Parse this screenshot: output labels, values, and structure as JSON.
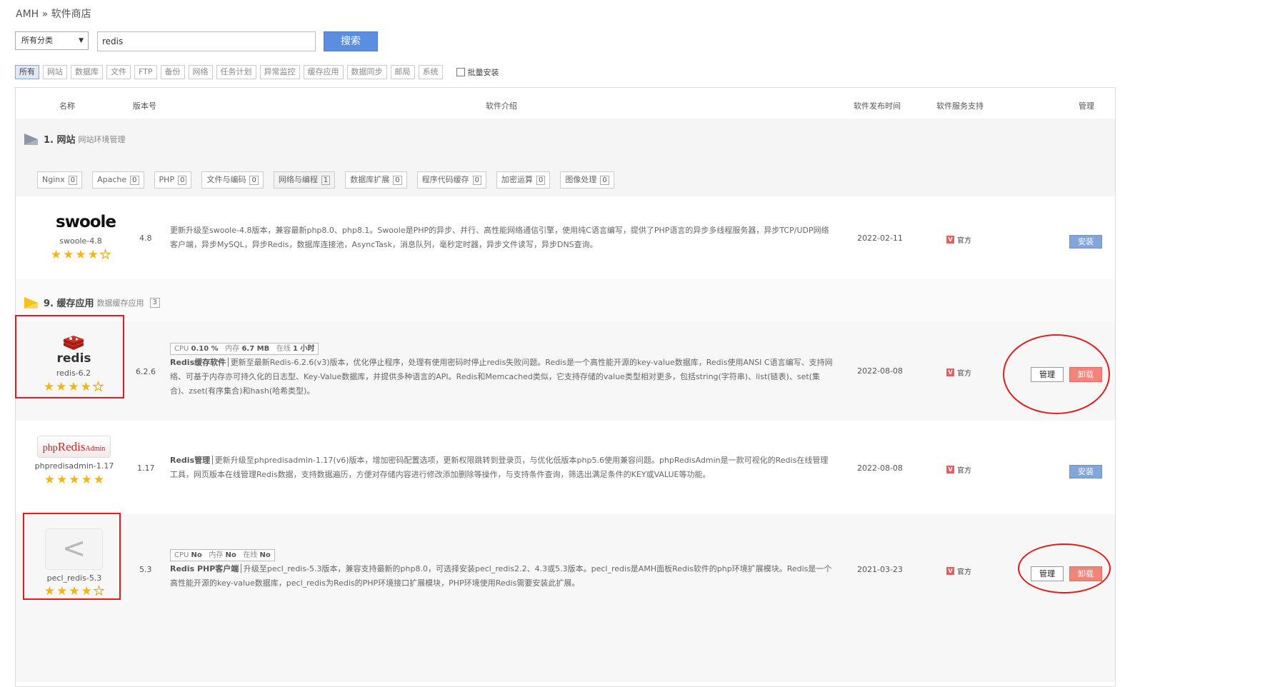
{
  "breadcrumb": "AMH » 软件商店",
  "search": {
    "category_value": "所有分类",
    "query": "redis",
    "button_label": "搜索"
  },
  "filter_tags": [
    "所有",
    "网站",
    "数据库",
    "文件",
    "FTP",
    "备份",
    "网络",
    "任务计划",
    "异常监控",
    "缓存应用",
    "数据同步",
    "邮局",
    "系统"
  ],
  "batch_install_label": "批量安装",
  "table_headers": {
    "name": "名称",
    "version": "版本号",
    "intro": "软件介绍",
    "release_date": "软件发布时间",
    "support": "软件服务支持",
    "manage": "管理"
  },
  "sections": {
    "website": {
      "title": "1. 网站",
      "desc": "网站环境管理",
      "subtags": [
        {
          "label": "Nginx",
          "count": "0"
        },
        {
          "label": "Apache",
          "count": "0"
        },
        {
          "label": "PHP",
          "count": "0"
        },
        {
          "label": "文件与编码",
          "count": "0"
        },
        {
          "label": "网络与编程",
          "count": "1"
        },
        {
          "label": "数据库扩展",
          "count": "0"
        },
        {
          "label": "程序代码缓存",
          "count": "0"
        },
        {
          "label": "加密运算",
          "count": "0"
        },
        {
          "label": "图像处理",
          "count": "0"
        }
      ]
    },
    "cache": {
      "title": "9. 缓存应用",
      "desc": "数据缓存应用",
      "count": "3"
    }
  },
  "packages": {
    "swoole": {
      "logo_text": "swoole",
      "name": "swoole-4.8",
      "version": "4.8",
      "rating": 4.5,
      "description": "更新升级至swoole-4.8版本，兼容最新php8.0、php8.1。Swoole是PHP的异步、并行、高性能网络通信引擎，使用纯C语言编写，提供了PHP语言的异步多线程服务器，异步TCP/UDP网络客户端，异步MySQL，异步Redis，数据库连接池，AsyncTask，消息队列，毫秒定时器，异步文件读写，异步DNS查询。",
      "release_date": "2022-02-11",
      "support_badge": "V",
      "support": "官方",
      "action": "安装"
    },
    "redis": {
      "logo_text": "redis",
      "name": "redis-6.2",
      "version": "6.2.6",
      "rating": 4.5,
      "stats": {
        "cpu_label": "CPU",
        "cpu": "0.10 %",
        "mem_label": "内存",
        "mem": "6.7 MB",
        "online_label": "在线",
        "online": "1 小时"
      },
      "desc_title": "Redis缓存软件",
      "description": "│更新至最新Redis-6.2.6(v3)版本，优化停止程序，处理有使用密码时停止redis失败问题。Redis是一个高性能开源的key-value数据库，Redis使用ANSI C语言编写、支持网络、可基于内存亦可持久化的日志型、Key-Value数据库，并提供多种语言的API。Redis和Memcached类似，它支持存储的value类型相对更多，包括string(字符串)、list(链表)、set(集合)、zset(有序集合)和hash(哈希类型)。",
      "release_date": "2022-08-08",
      "support_badge": "V",
      "support": "官方",
      "manage": "管理",
      "uninstall": "卸载"
    },
    "phpredisadmin": {
      "logo_main": "php",
      "logo_redis": "Redis",
      "logo_admin": "Admin",
      "name": "phpredisadmin-1.17",
      "version": "1.17",
      "rating": 5,
      "desc_title": "Redis管理",
      "description": "│更新升级至phpredisadmin-1.17(v6)版本，增加密码配置选项，更新权限跳转到登录页，与优化低版本php5.6使用兼容问题。phpRedisAdmin是一款可视化的Redis在线管理工具，网页版本在线管理Redis数据，支持数据遍历，方便对存储内容进行修改添加删除等操作，与支持条件查询，筛选出满足条件的KEY或VALUE等功能。",
      "release_date": "2022-08-08",
      "support_badge": "V",
      "support": "官方",
      "action": "安装"
    },
    "pecl_redis": {
      "logo_glyph": "<",
      "name": "pecl_redis-5.3",
      "version": "5.3",
      "rating": 4.5,
      "stats": {
        "cpu_label": "CPU",
        "cpu": "No",
        "mem_label": "内存",
        "mem": "No",
        "online_label": "在线",
        "online": "No"
      },
      "desc_title": "Redis PHP客户端",
      "description": "│升级至pecl_redis-5.3版本，兼容支持最新的php8.0，可选择安装pecl_redis2.2、4.3或5.3版本。pecl_redis是AMH面板Redis软件的php环境扩展模块。Redis是一个高性能开源的key-value数据库，pecl_redis为Redis的PHP环境接口扩展模块，PHP环境使用Redis需要安装此扩展。",
      "release_date": "2021-03-23",
      "support_badge": "V",
      "support": "官方",
      "manage": "管理",
      "uninstall": "卸载"
    }
  },
  "colors": {
    "accent": "#5b8ee0",
    "install": "#82a6dc",
    "uninstall": "#f4837a",
    "annotation": "#e21c1c",
    "star": "#f2b517"
  }
}
